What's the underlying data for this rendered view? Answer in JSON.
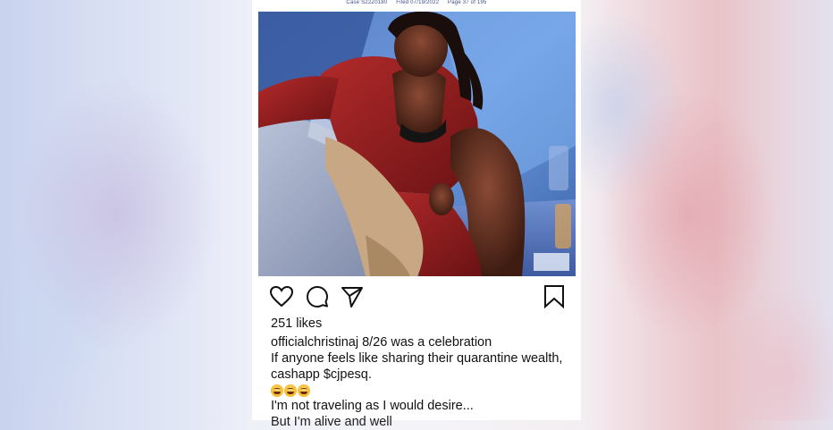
{
  "document_header": {
    "case": "Case S22Z0180",
    "filed": "Filed 07/19/2022",
    "page": "Page 37 of 195"
  },
  "post": {
    "photo_alt": "photo",
    "actions": {
      "like_icon": "heart-icon",
      "comment_icon": "comment-bubble-icon",
      "share_icon": "paper-plane-icon",
      "save_icon": "bookmark-icon"
    },
    "likes": "251 likes",
    "caption": {
      "username": "officialchristinaj",
      "first_line": "8/26 was a celebration",
      "line2": "If anyone feels like sharing their quarantine wealth,",
      "line3": "cashapp $cjpesq.",
      "emoji_count": 3,
      "line4": "I'm not traveling as I would desire...",
      "line5_partial": "But I'm alive and well"
    }
  },
  "colors": {
    "header_text": "#3b4b8c",
    "body_text": "#111111",
    "photo_wall_blue": "#4a6fb0",
    "dress_red": "#8e1b1e"
  }
}
